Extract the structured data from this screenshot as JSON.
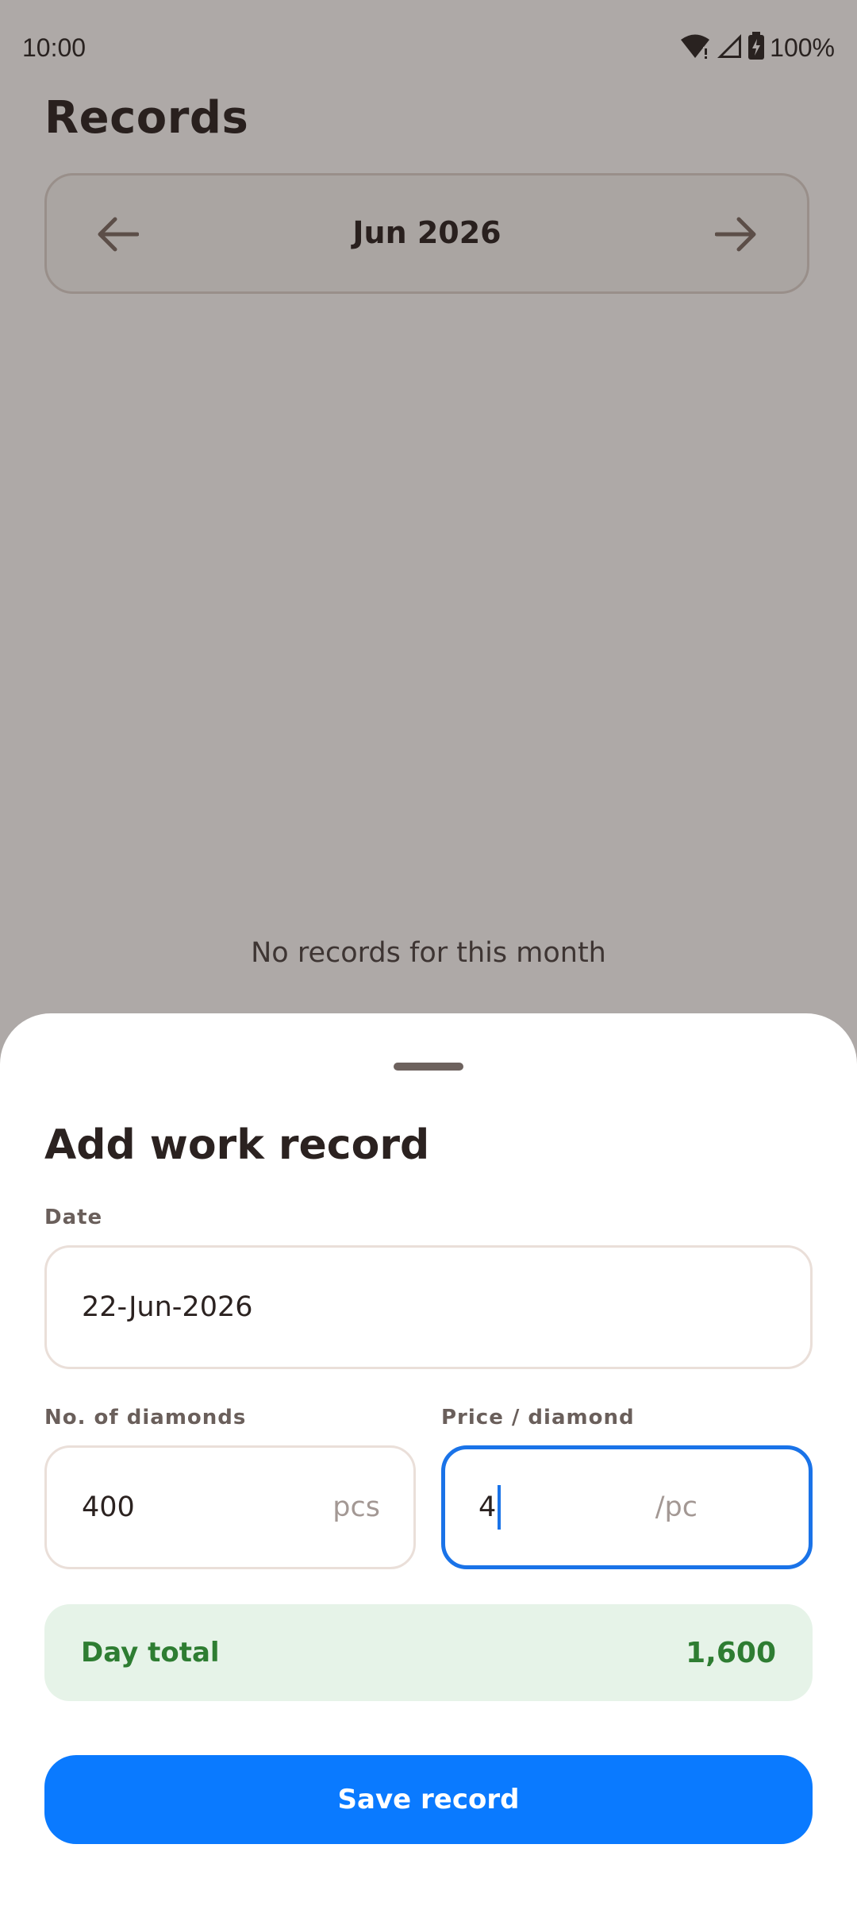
{
  "status_bar": {
    "time": "10:00",
    "battery": "100%"
  },
  "page": {
    "title": "Records",
    "month": "Jun 2026",
    "empty_message": "No records for this month"
  },
  "sheet": {
    "title": "Add work record",
    "date_label": "Date",
    "date_value": "22-Jun-2026",
    "diamonds_label": "No. of diamonds",
    "diamonds_value": "400",
    "diamonds_suffix": "pcs",
    "price_label": "Price / diamond",
    "price_value": "4",
    "price_suffix": "/pc",
    "total_label": "Day total",
    "total_value": "1,600",
    "save_label": "Save record"
  },
  "colors": {
    "accent": "#0a7aff",
    "focus": "#1a73e8",
    "total_bg": "#e6f3e8",
    "total_text": "#2e7d32"
  }
}
